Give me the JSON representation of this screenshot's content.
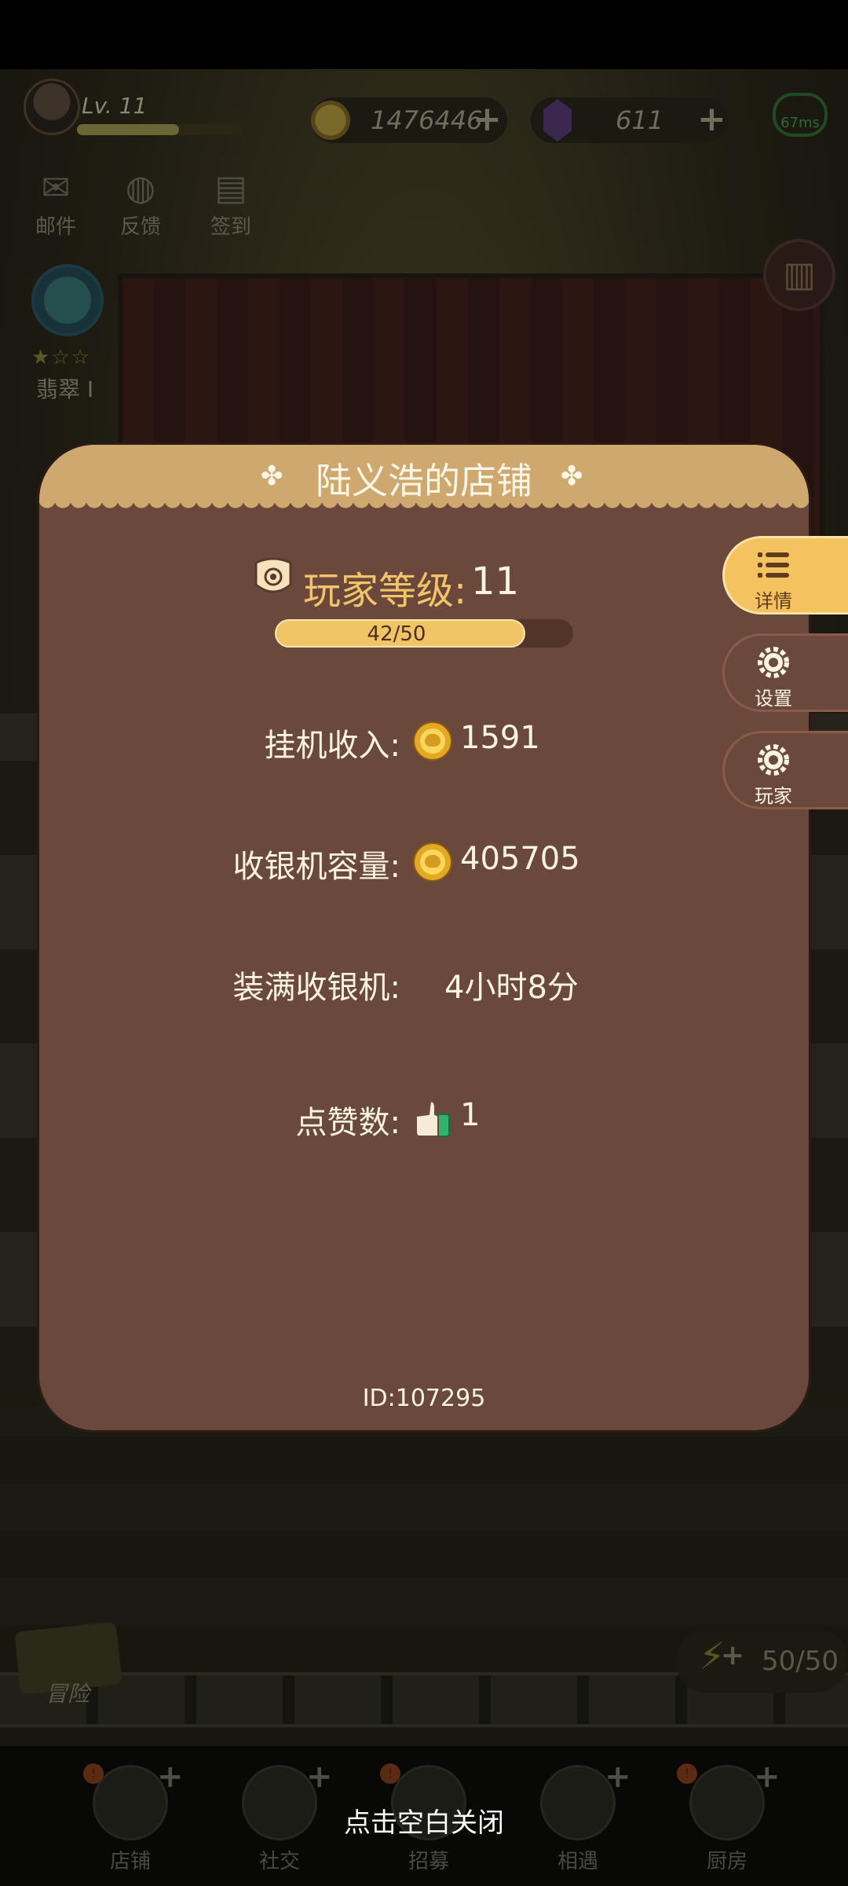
{
  "hud": {
    "level": "Lv. 11",
    "xp_fraction": 0.62,
    "coins": "1476446",
    "gems": "611",
    "ping": "67ms"
  },
  "left_icons": {
    "mail": "邮件",
    "feedback": "反馈",
    "checkin": "签到",
    "jade": "翡翠 I"
  },
  "energy": "50/50",
  "adventure": "冒险",
  "nav": [
    {
      "label": "店铺"
    },
    {
      "label": "社交"
    },
    {
      "label": "招募"
    },
    {
      "label": "相遇"
    },
    {
      "label": "厨房"
    }
  ],
  "close_hint": "点击空白关闭",
  "card": {
    "title": "陆义浩的店铺",
    "level_label": "玩家等级:",
    "level_value": "11",
    "progress_text": "42/50",
    "progress_fraction": 0.84,
    "stats": {
      "idle_income_label": "挂机收入:",
      "idle_income_value": "1591",
      "register_capacity_label": "收银机容量:",
      "register_capacity_value": "405705",
      "fill_register_label": "装满收银机:",
      "fill_register_value": "4小时8分",
      "likes_label": "点赞数:",
      "likes_value": "1"
    },
    "id_text": "ID:107295"
  },
  "tabs": [
    {
      "label": "详情",
      "icon": "list-icon",
      "active": true
    },
    {
      "label": "设置",
      "icon": "gear-icon",
      "active": false
    },
    {
      "label": "玩家",
      "icon": "gear-icon",
      "active": false
    }
  ],
  "colors": {
    "card_bg": "#6b483c",
    "header_bg": "#cfa870",
    "accent_gold": "#f2c46a",
    "active_tab": "#f4c35f"
  }
}
